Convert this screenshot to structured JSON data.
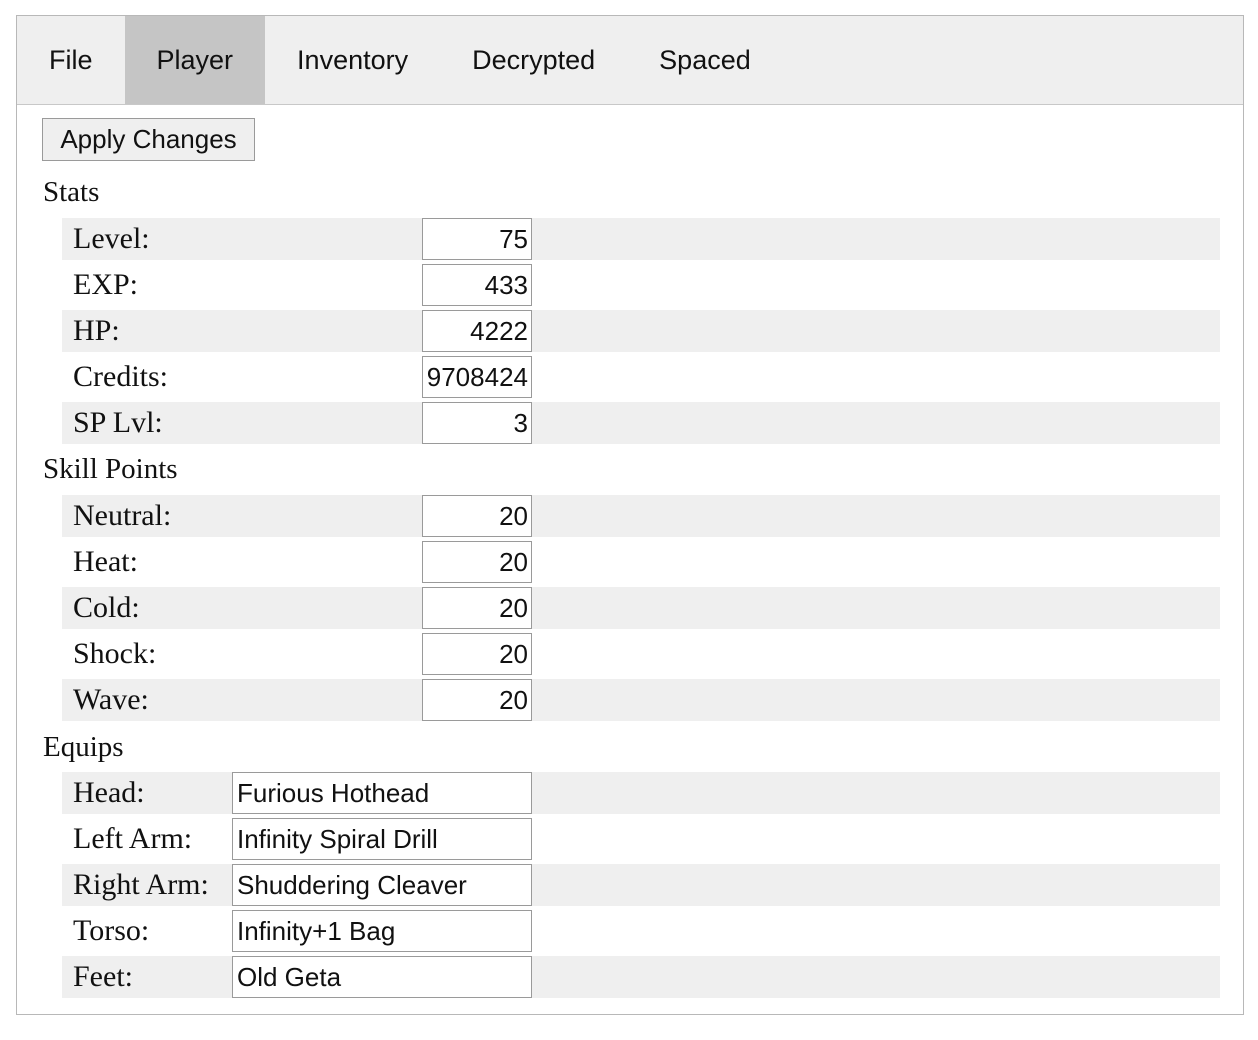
{
  "tabs": [
    {
      "label": "File"
    },
    {
      "label": "Player",
      "active": true
    },
    {
      "label": "Inventory"
    },
    {
      "label": "Decrypted"
    },
    {
      "label": "Spaced"
    }
  ],
  "apply_label": "Apply Changes",
  "stats": {
    "title": "Stats",
    "level": {
      "label": "Level:",
      "value": "75"
    },
    "exp": {
      "label": "EXP:",
      "value": "433"
    },
    "hp": {
      "label": "HP:",
      "value": "4222"
    },
    "credits": {
      "label": "Credits:",
      "value": "9708424"
    },
    "sp_lvl": {
      "label": "SP Lvl:",
      "value": "3"
    }
  },
  "skill_points": {
    "title": "Skill Points",
    "neutral": {
      "label": "Neutral:",
      "value": "20"
    },
    "heat": {
      "label": "Heat:",
      "value": "20"
    },
    "cold": {
      "label": "Cold:",
      "value": "20"
    },
    "shock": {
      "label": "Shock:",
      "value": "20"
    },
    "wave": {
      "label": "Wave:",
      "value": "20"
    }
  },
  "equips": {
    "title": "Equips",
    "head": {
      "label": "Head:",
      "value": "Furious Hothead"
    },
    "left_arm": {
      "label": "Left Arm:",
      "value": "Infinity Spiral Drill"
    },
    "right_arm": {
      "label": "Right Arm:",
      "value": "Shuddering Cleaver"
    },
    "torso": {
      "label": "Torso:",
      "value": "Infinity+1 Bag"
    },
    "feet": {
      "label": "Feet:",
      "value": "Old Geta"
    }
  }
}
